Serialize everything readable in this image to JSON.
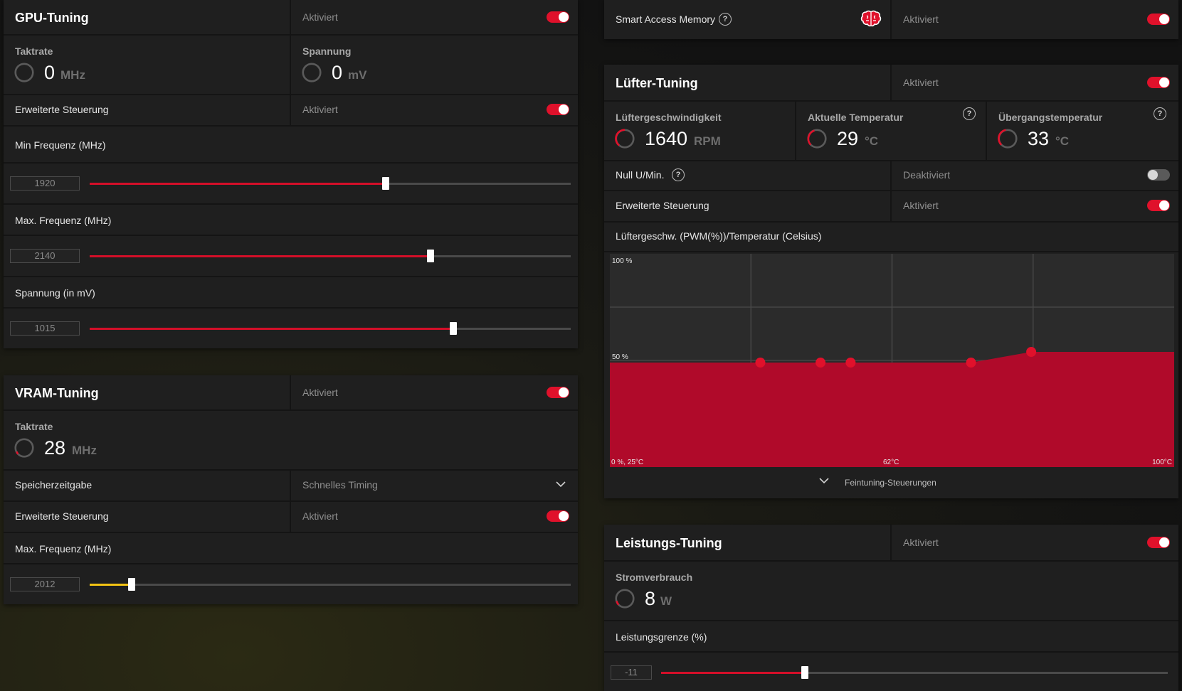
{
  "gpu": {
    "title": "GPU-Tuning",
    "status": "Aktiviert",
    "clock": {
      "label": "Taktrate",
      "value": "0",
      "unit": "MHz"
    },
    "voltage": {
      "label": "Spannung",
      "value": "0",
      "unit": "mV"
    },
    "advanced": {
      "label": "Erweiterte Steuerung",
      "status": "Aktiviert"
    },
    "min_freq": {
      "label": "Min Frequenz (MHz)",
      "value": "1920",
      "fraction": 0.615
    },
    "max_freq": {
      "label": "Max. Frequenz (MHz)",
      "value": "2140",
      "fraction": 0.709
    },
    "voltage_slider": {
      "label": "Spannung (in mV)",
      "value": "1015",
      "fraction": 0.756
    }
  },
  "vram": {
    "title": "VRAM-Tuning",
    "status": "Aktiviert",
    "clock": {
      "label": "Taktrate",
      "value": "28",
      "unit": "MHz"
    },
    "timing": {
      "label": "Speicherzeitgabe",
      "value": "Schnelles Timing"
    },
    "advanced": {
      "label": "Erweiterte Steuerung",
      "status": "Aktiviert"
    },
    "max_freq": {
      "label": "Max. Frequenz (MHz)",
      "value": "2012",
      "fraction": 0.088
    }
  },
  "sam": {
    "label": "Smart Access Memory",
    "help": "?",
    "status": "Aktiviert"
  },
  "fan": {
    "title": "Lüfter-Tuning",
    "status": "Aktiviert",
    "speed": {
      "label": "Lüftergeschwindigkeit",
      "value": "1640",
      "unit": "RPM"
    },
    "temp": {
      "label": "Aktuelle Temperatur",
      "value": "29",
      "unit": "°C",
      "help": "?"
    },
    "junction": {
      "label": "Übergangstemperatur",
      "value": "33",
      "unit": "°C",
      "help": "?"
    },
    "zero_rpm": {
      "label": "Null U/Min.",
      "help": "?",
      "status": "Deaktiviert"
    },
    "advanced": {
      "label": "Erweiterte Steuerung",
      "status": "Aktiviert"
    },
    "curve_label": "Lüftergeschw. (PWM(%))/Temperatur (Celsius)",
    "fine_tuning": "Feintuning-Steuerungen"
  },
  "power": {
    "title": "Leistungs-Tuning",
    "status": "Aktiviert",
    "consumption": {
      "label": "Stromverbrauch",
      "value": "8",
      "unit": "W"
    },
    "limit": {
      "label": "Leistungsgrenze (%)",
      "value": "-11",
      "fraction": 0.284
    }
  },
  "chart_data": {
    "type": "area",
    "title": "Lüftergeschw. (PWM(%))/Temperatur (Celsius)",
    "y_top_label": "100 %",
    "y_mid_label": "50 %",
    "x_start_label": "0 %, 25°C",
    "x_mid_label": "62°C",
    "x_end_label": "100°C",
    "xlim": [
      25,
      100
    ],
    "ylim": [
      0,
      100
    ],
    "points": [
      {
        "x": 25,
        "y": 49
      },
      {
        "x": 45,
        "y": 49
      },
      {
        "x": 53,
        "y": 49
      },
      {
        "x": 57,
        "y": 49
      },
      {
        "x": 73,
        "y": 49
      },
      {
        "x": 81,
        "y": 54
      },
      {
        "x": 100,
        "y": 54
      }
    ],
    "handles": [
      1,
      2,
      3,
      4,
      5
    ],
    "grid": true,
    "fill_color": "#b00a2a",
    "handle_color": "#e0112b"
  },
  "colors": {
    "accent": "#e0112b",
    "vram_fill": "#f2c313",
    "slider_fill": "#d40f29"
  }
}
